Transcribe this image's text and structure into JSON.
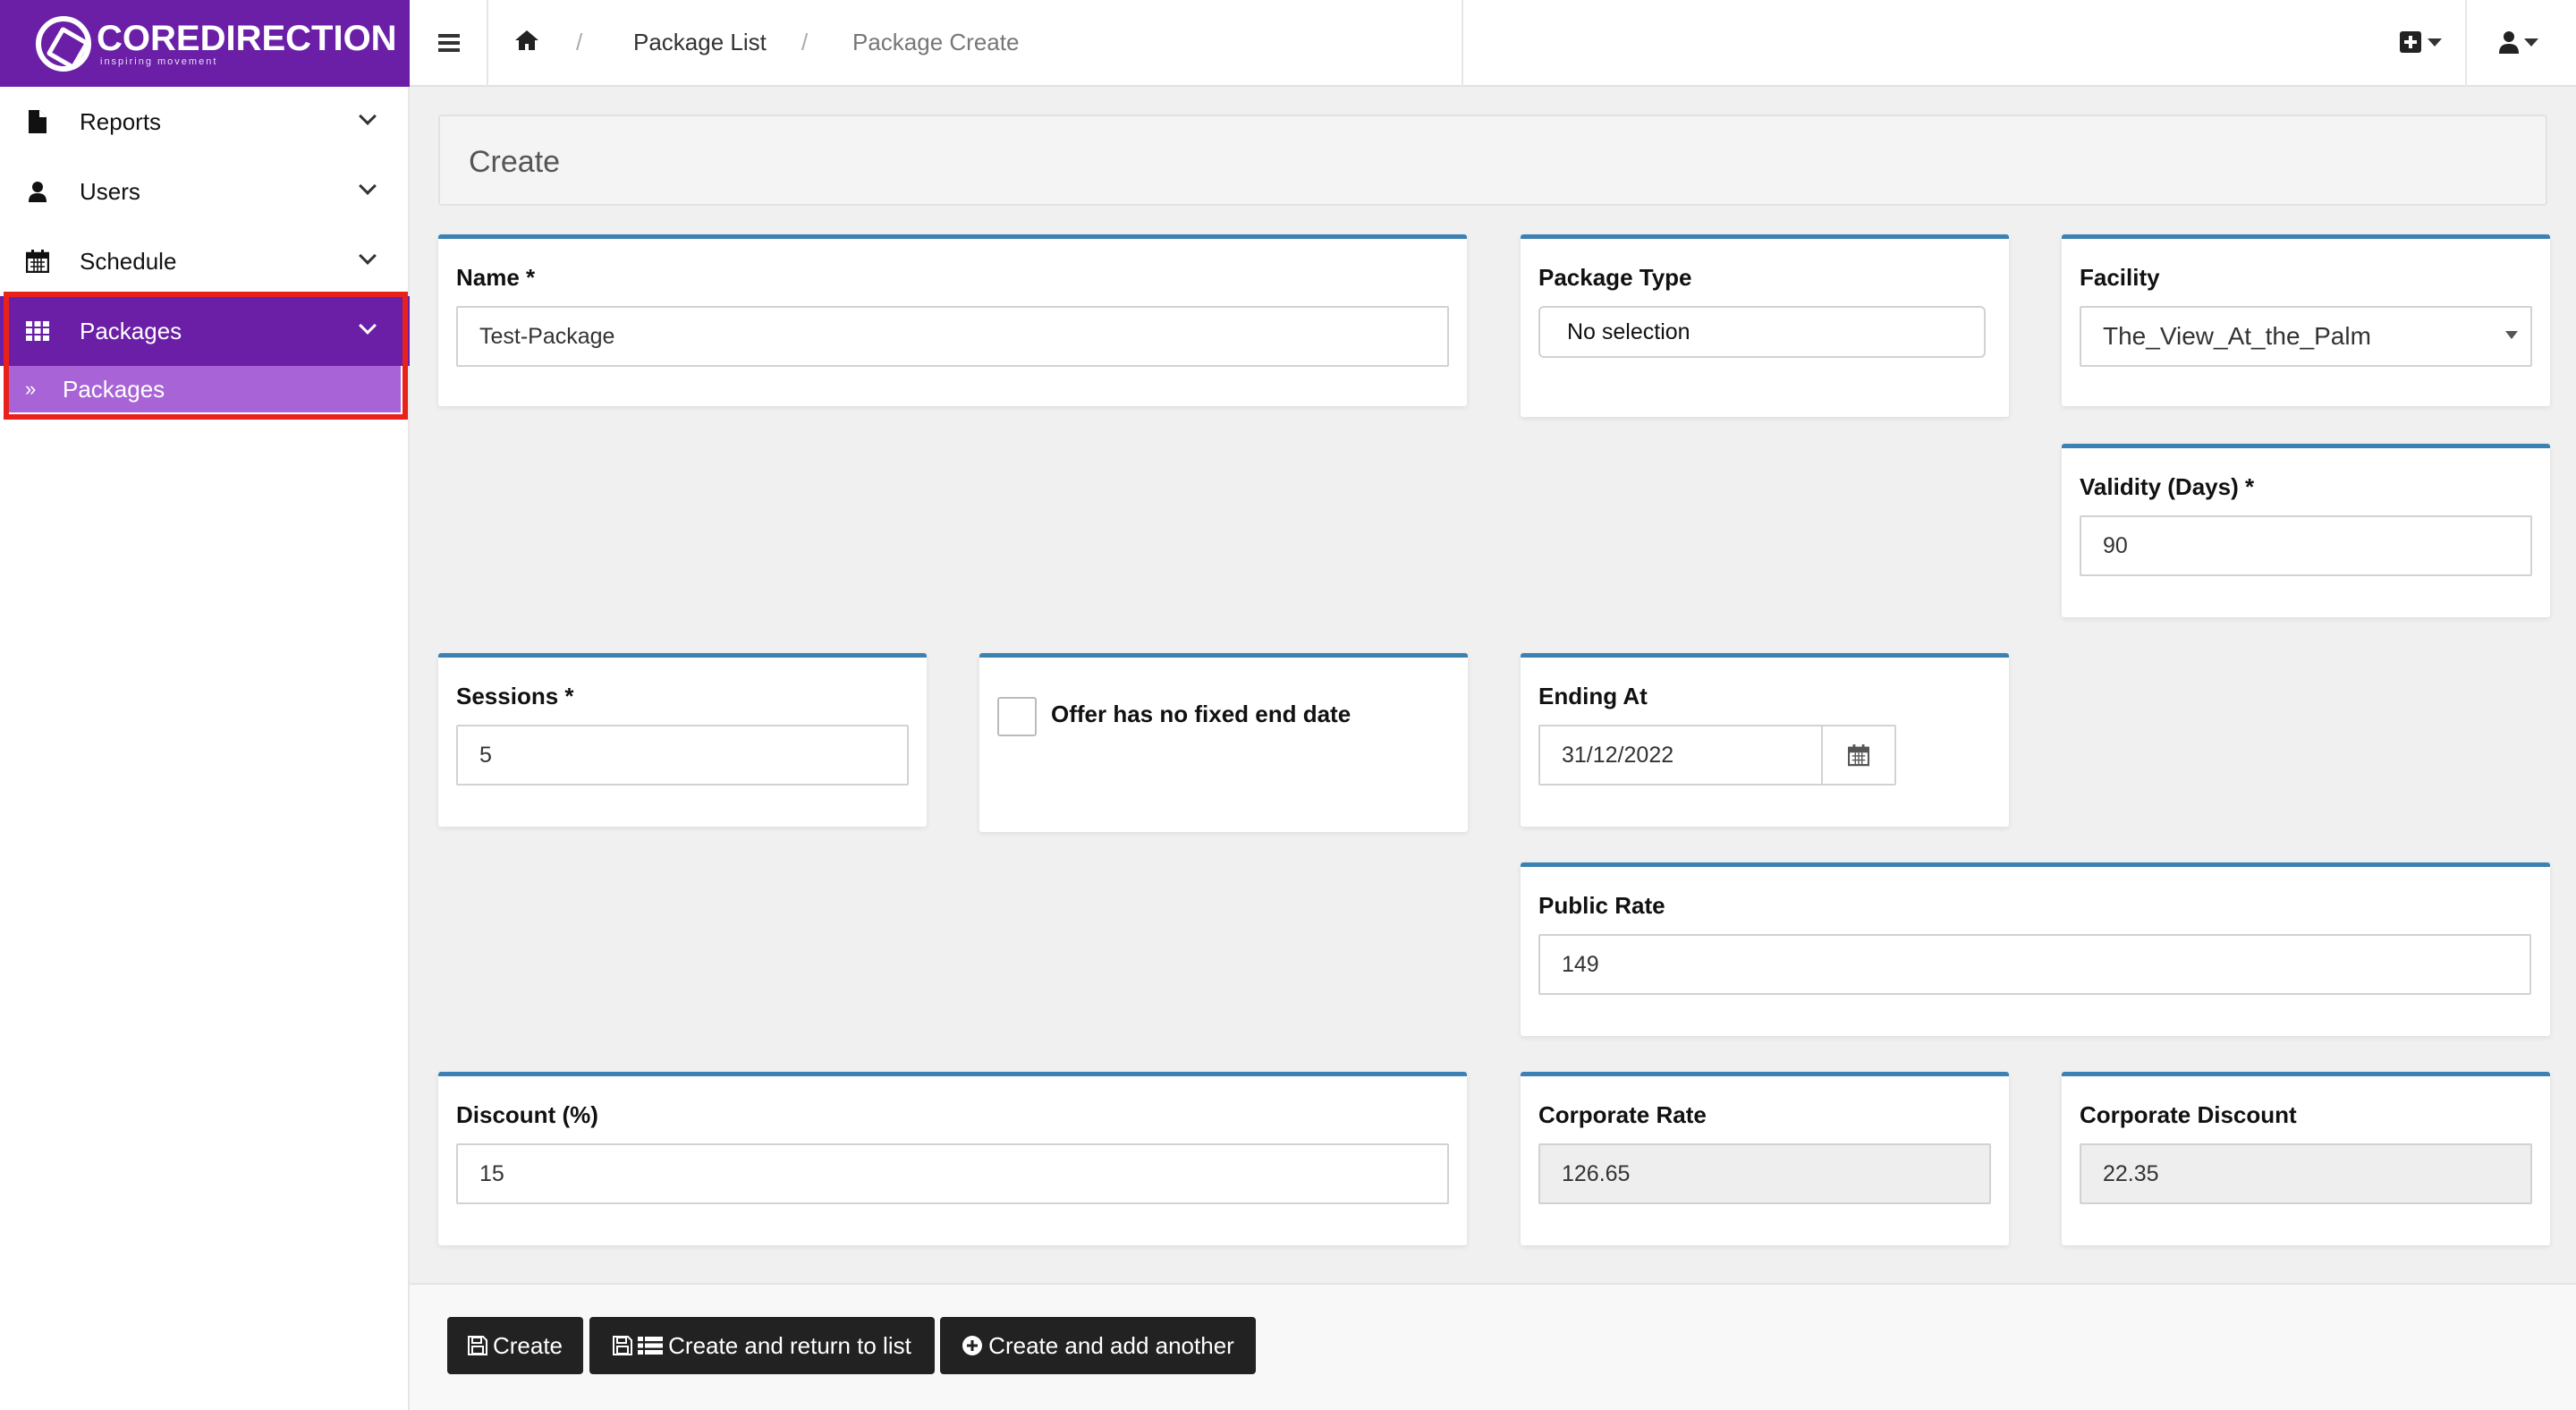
{
  "brand": {
    "name": "COREDIRECTION",
    "tagline": "inspiring movement",
    "color": "#6a1fa6"
  },
  "sidebar": {
    "items": [
      {
        "label": "Reports",
        "icon": "file-icon"
      },
      {
        "label": "Users",
        "icon": "user-icon"
      },
      {
        "label": "Schedule",
        "icon": "calendar-icon"
      },
      {
        "label": "Packages",
        "icon": "grid-icon",
        "active": true
      }
    ],
    "sub_item": {
      "label": "Packages",
      "icon": "double-chevron-right-icon"
    },
    "highlight_color": "#e8221b"
  },
  "breadcrumb": {
    "items": [
      "Package List",
      "Package Create"
    ]
  },
  "page": {
    "heading": "Create"
  },
  "form": {
    "name": {
      "label": "Name *",
      "value": "Test-Package"
    },
    "package_type": {
      "label": "Package Type",
      "value": "No selection"
    },
    "facility": {
      "label": "Facility",
      "value": "The_View_At_the_Palm"
    },
    "validity": {
      "label": "Validity (Days) *",
      "value": "90"
    },
    "sessions": {
      "label": "Sessions *",
      "value": "5"
    },
    "no_end_date": {
      "label": "Offer has no fixed end date",
      "checked": false
    },
    "ending_at": {
      "label": "Ending At",
      "value": "31/12/2022"
    },
    "public_rate": {
      "label": "Public Rate",
      "value": "149"
    },
    "discount": {
      "label": "Discount (%)",
      "value": "15"
    },
    "corporate_rate": {
      "label": "Corporate Rate",
      "value": "126.65"
    },
    "corporate_discount": {
      "label": "Corporate Discount",
      "value": "22.35"
    }
  },
  "actions": {
    "create": "Create",
    "create_return": "Create and return to list",
    "create_another": "Create and add another"
  }
}
